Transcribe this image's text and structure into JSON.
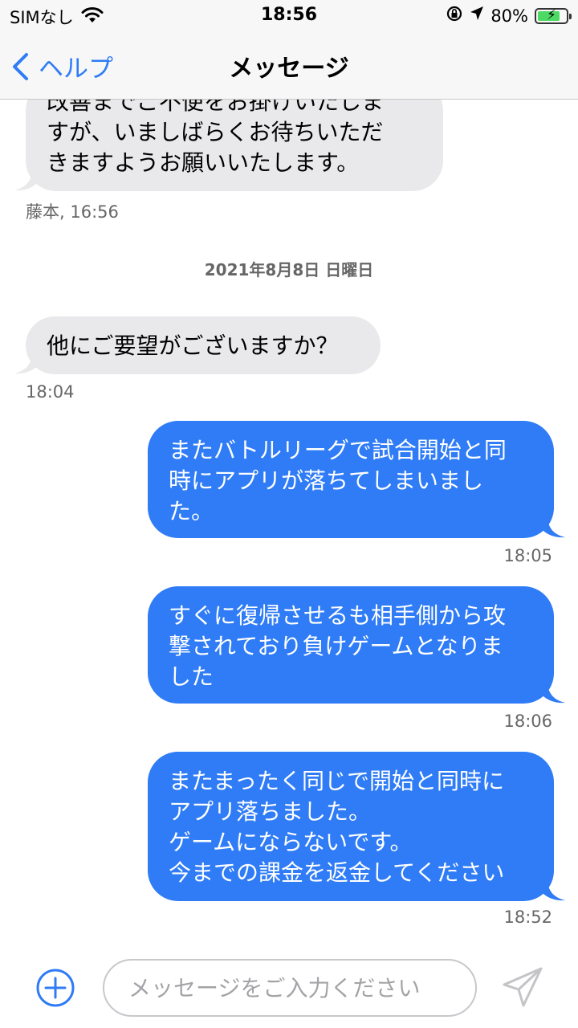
{
  "status": {
    "carrier": "SIMなし",
    "time": "18:56",
    "battery": "80%",
    "battery_level": 0.8
  },
  "nav": {
    "back_label": "ヘルプ",
    "title": "メッセージ"
  },
  "messages": {
    "m0": {
      "text": "改善までご不便をお掛けいたしま\nすが、いましばらくお待ちいただ\nきますようお願いいたします。",
      "meta": "藤本, 16:56"
    },
    "date": "2021年8月8日 日曜日",
    "m1": {
      "text": "他にご要望がございますか？",
      "meta": "18:04"
    },
    "m2": {
      "text": "またバトルリーグで試合開始と同\n時にアプリが落ちてしまいまし\nた。",
      "meta": "18:05"
    },
    "m3": {
      "text": "すぐに復帰させるも相手側から攻\n撃されており負けゲームとなりま\nした",
      "meta": "18:06"
    },
    "m4": {
      "text": "またまったく同じで開始と同時に\nアプリ落ちました。\nゲームにならないです。\n今までの課金を返金してください",
      "meta": "18:52"
    }
  },
  "composer": {
    "placeholder": "メッセージをご入力ください"
  },
  "colors": {
    "accent": "#2f7cf6",
    "incoming_bubble": "#e9e9eb",
    "battery_fill": "#4cd964"
  }
}
